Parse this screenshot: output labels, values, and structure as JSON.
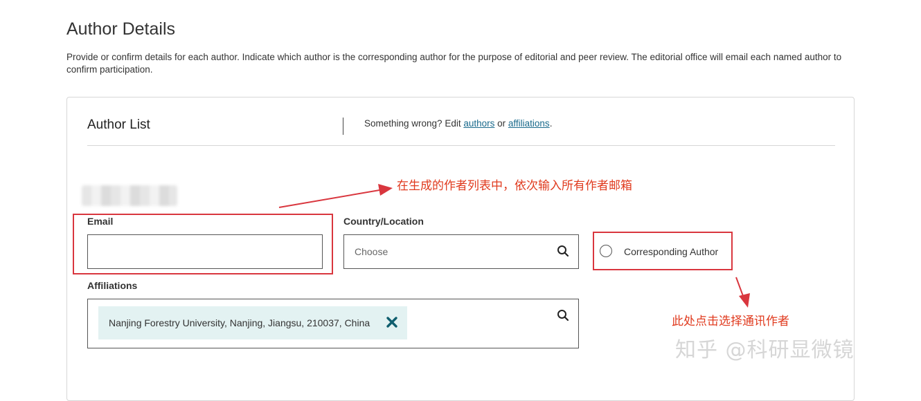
{
  "page": {
    "title": "Author Details",
    "description": "Provide or confirm details for each author. Indicate which author is the corresponding author for the purpose of editorial and peer review. The editorial office will email each named author to confirm participation."
  },
  "author_list": {
    "title": "Author List",
    "edit_prefix": "Something wrong? Edit ",
    "authors_link": "authors",
    "edit_or": " or ",
    "affiliations_link": "affiliations",
    "edit_suffix": "."
  },
  "form": {
    "email_label": "Email",
    "email_value": "",
    "country_label": "Country/Location",
    "country_placeholder": "Choose",
    "corresponding_label": "Corresponding Author",
    "corresponding_checked": false,
    "affiliations_label": "Affiliations",
    "affiliations": [
      "Nanjing Forestry University, Nanjing, Jiangsu, 210037, China"
    ]
  },
  "annotations": {
    "email_note": "在生成的作者列表中，依次输入所有作者邮箱",
    "corresponding_note": "此处点击选择通讯作者"
  },
  "watermark": "知乎 @科研显微镜",
  "colors": {
    "annotation_red": "#d9363e",
    "link_blue": "#1a6a8c",
    "chip_bg": "#e3f2f2",
    "chip_x": "#0f5e6e"
  },
  "icons": {
    "search": "search-icon",
    "remove": "close-icon"
  }
}
